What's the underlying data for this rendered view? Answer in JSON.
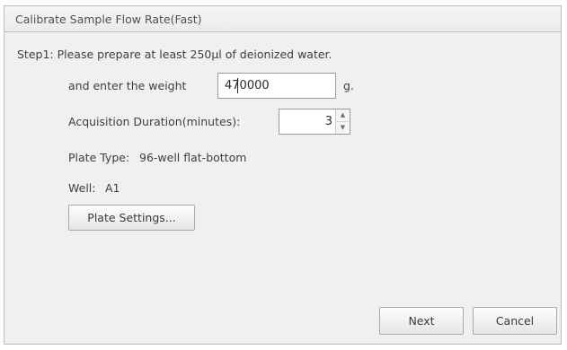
{
  "dialog": {
    "title": "Calibrate Sample Flow Rate(Fast)"
  },
  "step": {
    "instruction": "Step1: Please prepare at least 250μl of deionized water.",
    "weight_label": "and enter the weight",
    "weight_value": "470000",
    "weight_unit": "g.",
    "duration_label": "Acquisition Duration(minutes):",
    "duration_value": "3",
    "plate_type_label": "Plate Type:",
    "plate_type_value": "96-well flat-bottom",
    "well_label": "Well:",
    "well_value": "A1",
    "plate_settings_button": "Plate Settings..."
  },
  "footer": {
    "next_button": "Next",
    "cancel_button": "Cancel"
  }
}
